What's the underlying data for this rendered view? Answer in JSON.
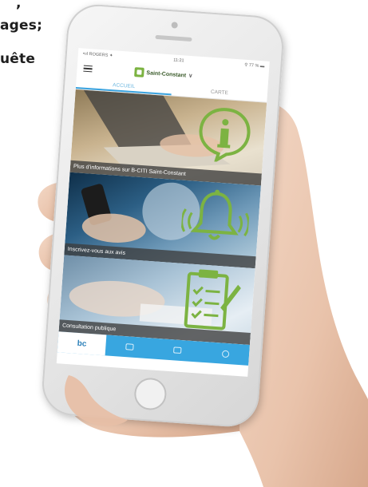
{
  "background_text": {
    "line1": ", ",
    "line2": "ages;",
    "line3": "uête"
  },
  "status_bar": {
    "carrier": "•ııl ROGERS ✦",
    "time": "11:21",
    "battery": "⚲ 77 % ▬"
  },
  "header": {
    "brand": "Saint-Constant",
    "chevron": "∨"
  },
  "tabs": [
    {
      "label": "ACCUEIL",
      "active": true
    },
    {
      "label": "CARTE",
      "active": false
    }
  ],
  "tiles": [
    {
      "caption": "Plus d'informations sur B-CITI Saint-Constant",
      "icon": "info-speech-bubble-icon"
    },
    {
      "caption": "Inscrivez-vous aux avis",
      "icon": "ringing-bell-icon"
    },
    {
      "caption": "Consultation publique",
      "icon": "clipboard-checklist-icon"
    }
  ],
  "bottom_nav": [
    {
      "label": "bc",
      "icon": "bciti-logo-icon",
      "active": true
    },
    {
      "label": "",
      "icon": "chat-icon",
      "active": false
    },
    {
      "label": "",
      "icon": "dashboard-icon",
      "active": false
    },
    {
      "label": "",
      "icon": "profile-icon",
      "active": false
    }
  ],
  "colors": {
    "accent_blue": "#38a6e0",
    "icon_green": "#7cb342",
    "caption_bg": "#3c3c3c"
  }
}
